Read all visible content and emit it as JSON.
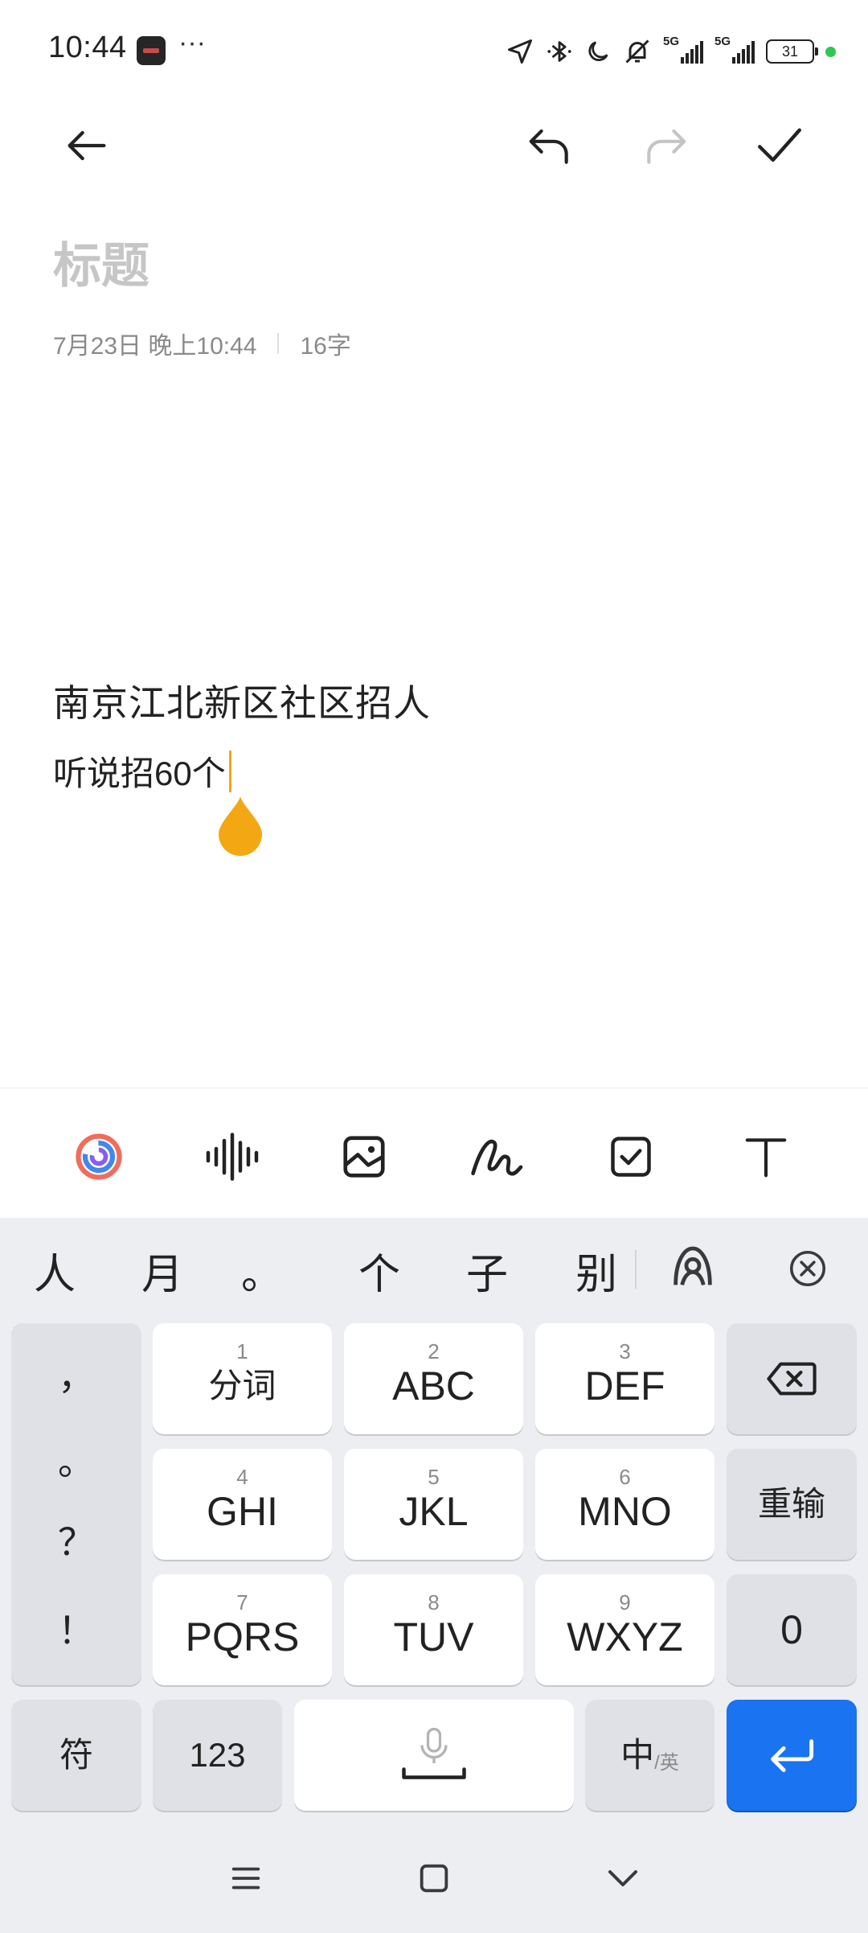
{
  "status_bar": {
    "time": "10:44",
    "more": "···",
    "network_1": "5G",
    "network_2": "5G",
    "battery": "31",
    "icons": [
      "location-arrow-icon",
      "bluetooth-icon",
      "moon-icon",
      "bell-off-icon",
      "signal-icon",
      "signal-icon",
      "battery-icon"
    ]
  },
  "note": {
    "title_placeholder": "标题",
    "date": "7月23日 晚上10:44",
    "char_count": "16字",
    "line1": "南京江北新区社区招人",
    "line2": "听说招60个"
  },
  "format_toolbar": {
    "icons": [
      "ai-swirl-icon",
      "voice-wave-icon",
      "image-icon",
      "handwriting-icon",
      "checkbox-icon",
      "text-format-icon"
    ]
  },
  "keyboard": {
    "candidates": [
      "人",
      "月",
      "。",
      "个",
      "子",
      "别"
    ],
    "punctuation": [
      "，",
      "。",
      "？",
      "！"
    ],
    "keys": [
      {
        "num": "1",
        "label": "分词"
      },
      {
        "num": "2",
        "label": "ABC"
      },
      {
        "num": "3",
        "label": "DEF"
      },
      {
        "num": "4",
        "label": "GHI"
      },
      {
        "num": "5",
        "label": "JKL"
      },
      {
        "num": "6",
        "label": "MNO"
      },
      {
        "num": "7",
        "label": "PQRS"
      },
      {
        "num": "8",
        "label": "TUV"
      },
      {
        "num": "9",
        "label": "WXYZ"
      }
    ],
    "reinput": "重输",
    "zero": "0",
    "symbols": "符",
    "numbers": "123",
    "lang_main": "中",
    "lang_sub": "/英",
    "accent_color": "#1a73f0"
  },
  "colors": {
    "cursor": "#f3a712",
    "background": "#ffffff",
    "keyboard_bg": "#eceef2"
  }
}
